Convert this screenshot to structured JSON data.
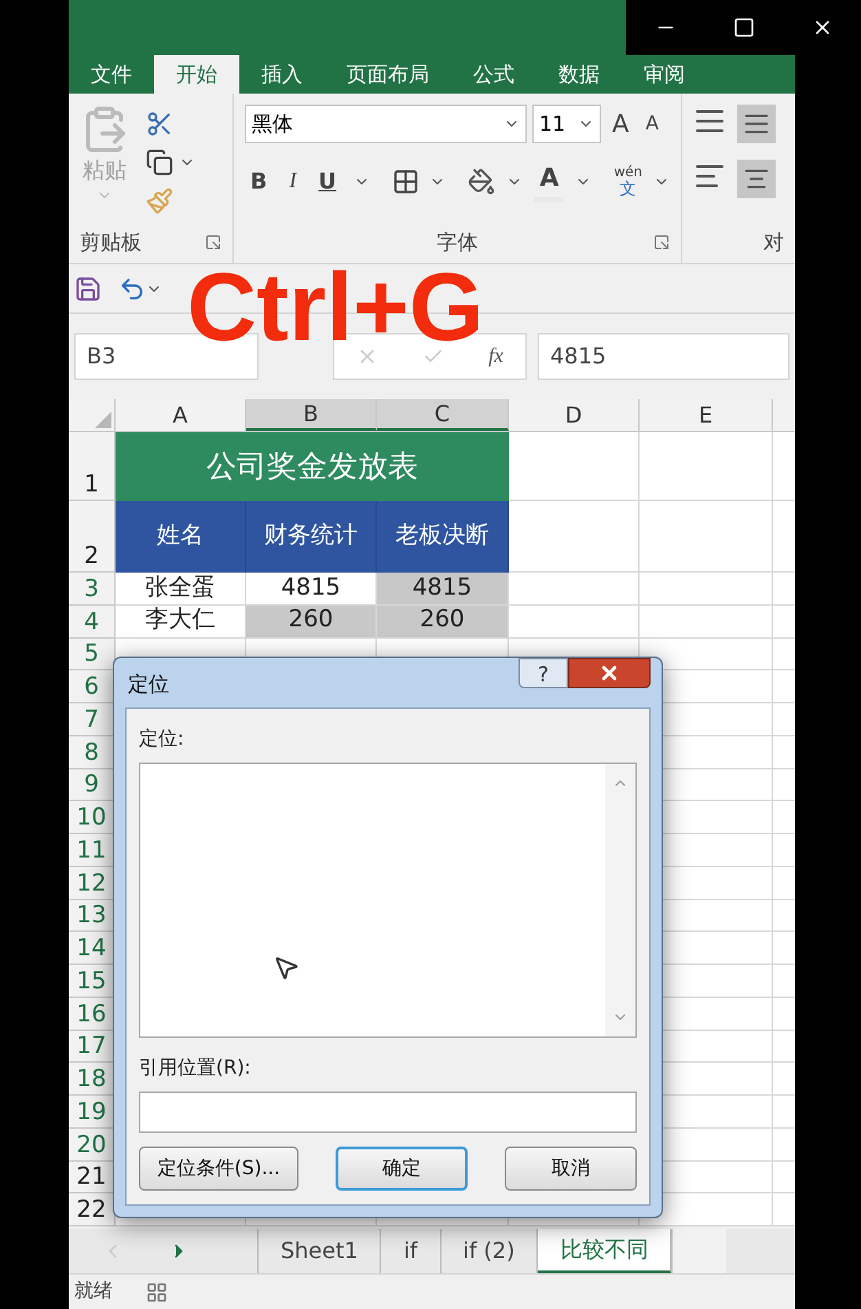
{
  "ribbon_tabs": [
    {
      "label": "文件",
      "selected": false
    },
    {
      "label": "开始",
      "selected": true
    },
    {
      "label": "插入",
      "selected": false
    },
    {
      "label": "页面布局",
      "selected": false
    },
    {
      "label": "公式",
      "selected": false
    },
    {
      "label": "数据",
      "selected": false
    },
    {
      "label": "审阅",
      "selected": false
    }
  ],
  "ribbon": {
    "clipboard": {
      "paste_label": "粘贴",
      "group_label": "剪贴板"
    },
    "font": {
      "font_name": "黑体",
      "font_size": "11",
      "grow_font": "A",
      "shrink_font": "A",
      "bold": "B",
      "italic": "I",
      "underline": "U",
      "font_color": "A",
      "phonetic_top": "wén",
      "phonetic_bottom": "文",
      "group_label": "字体"
    },
    "alignment": {
      "group_label": "对"
    }
  },
  "overlay_caption": "Ctrl+G",
  "formula_bar": {
    "name_box": "B3",
    "function_symbol": "fx",
    "formula": "4815"
  },
  "columns": [
    {
      "label": "A",
      "selected": false
    },
    {
      "label": "B",
      "selected": true
    },
    {
      "label": "C",
      "selected": true
    },
    {
      "label": "D",
      "selected": false
    },
    {
      "label": "E",
      "selected": false
    }
  ],
  "row_headers": [
    {
      "label": "1",
      "selected": false
    },
    {
      "label": "2",
      "selected": false
    },
    {
      "label": "3",
      "selected": true
    },
    {
      "label": "4",
      "selected": true
    },
    {
      "label": "5",
      "selected": true
    },
    {
      "label": "6",
      "selected": true
    },
    {
      "label": "7",
      "selected": true
    },
    {
      "label": "8",
      "selected": true
    },
    {
      "label": "9",
      "selected": true
    },
    {
      "label": "10",
      "selected": true
    },
    {
      "label": "11",
      "selected": true
    },
    {
      "label": "12",
      "selected": true
    },
    {
      "label": "13",
      "selected": true
    },
    {
      "label": "14",
      "selected": true
    },
    {
      "label": "15",
      "selected": true
    },
    {
      "label": "16",
      "selected": true
    },
    {
      "label": "17",
      "selected": true
    },
    {
      "label": "18",
      "selected": true
    },
    {
      "label": "19",
      "selected": true
    },
    {
      "label": "20",
      "selected": true
    },
    {
      "label": "21",
      "selected": false
    },
    {
      "label": "22",
      "selected": false
    }
  ],
  "sheet": {
    "title": "公司奖金发放表",
    "headers": [
      "姓名",
      "财务统计",
      "老板决断"
    ],
    "rows": [
      [
        {
          "text": "张全蛋",
          "selected": false
        },
        {
          "text": "4815",
          "selected": false
        },
        {
          "text": "4815",
          "selected": true
        }
      ],
      [
        {
          "text": "李大仁",
          "selected": false
        },
        {
          "text": "260",
          "selected": true
        },
        {
          "text": "260",
          "selected": true
        }
      ]
    ]
  },
  "sheet_tabs": [
    {
      "label": "Sheet1",
      "selected": false
    },
    {
      "label": "if",
      "selected": false
    },
    {
      "label": "if (2)",
      "selected": false
    },
    {
      "label": "比较不同",
      "selected": true
    }
  ],
  "status_bar": {
    "status": "就绪"
  },
  "dialog": {
    "title": "定位",
    "help": "?",
    "goto_label": "定位:",
    "reference_label": "引用位置(R):",
    "buttons": [
      {
        "label": "定位条件(S)...",
        "default": false
      },
      {
        "label": "确定",
        "default": true
      },
      {
        "label": "取消",
        "default": false
      }
    ]
  }
}
